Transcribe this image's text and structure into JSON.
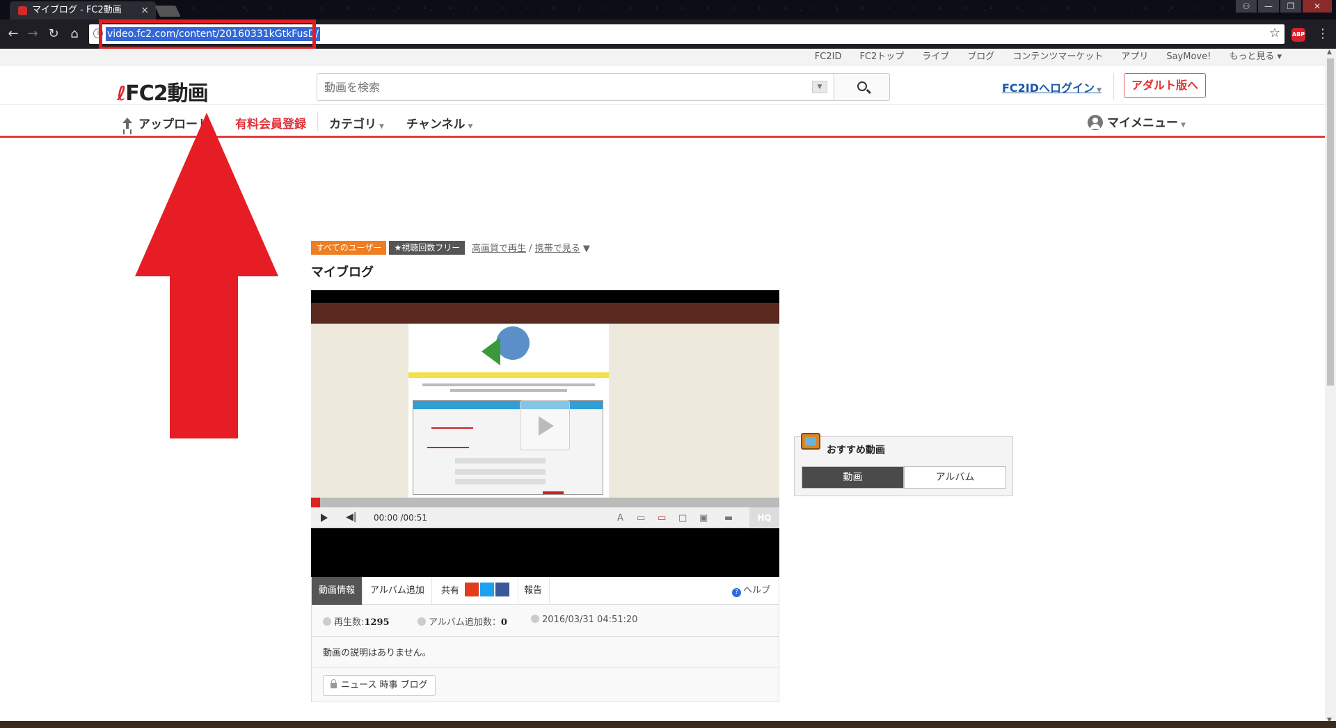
{
  "browser": {
    "tab_title": "マイブログ - FC2動画",
    "tab_close": "×",
    "url": "video.fc2.com/content/20160331kGtkFusD/",
    "abp_label": "ABP",
    "nav": {
      "back": "←",
      "forward": "→",
      "reload": "↻",
      "home": "⌂",
      "star": "☆",
      "menu": "⋮"
    },
    "window_controls": {
      "user": "⚇",
      "minimize": "—",
      "maximize": "❐",
      "close": "✕"
    }
  },
  "topnav": {
    "items": [
      "FC2ID",
      "FC2トップ",
      "ライブ",
      "ブログ",
      "コンテンツマーケット",
      "アプリ",
      "SayMove!",
      "もっと見る ▾"
    ]
  },
  "header": {
    "logo_text": "FC2動画",
    "search_placeholder": "動画を検索",
    "login_label": "FC2IDへログイン",
    "adult_label": "アダルト版へ"
  },
  "subnav": {
    "upload_label": "アップロード",
    "premium_label": "有料会員登録",
    "category_label": "カテゴリ",
    "channel_label": "チャンネル",
    "mymenu_label": "マイメニュー"
  },
  "video": {
    "tag_all": "すべてのユーザー",
    "tag_free": "★視聴回数フリー",
    "hq_link": "高画質で再生",
    "link_sep": "/",
    "mobile_link": "携帯で見る",
    "link_caret": "▼",
    "title": "マイブログ",
    "time": "00:00 /00:51",
    "hq_button": "HQ",
    "progress": 0.02
  },
  "video_tabs": {
    "info": "動画情報",
    "album_add": "アルバム追加",
    "share": "共有",
    "report": "報告",
    "help": "ヘルプ"
  },
  "stats": {
    "plays_label": "再生数:",
    "plays": "1295",
    "album_label": "アルバム追加数：",
    "album_count": "0",
    "date": "2016/03/31 04:51:20"
  },
  "description": "動画の説明はありません。",
  "video_tag": "ニュース 時事 ブログ",
  "recommend": {
    "title": "おすすめ動画",
    "tab_video": "動画",
    "tab_album": "アルバム"
  },
  "colors": {
    "annotation_red": "#e11d24",
    "fc2_red": "#e0323a",
    "tag_orange": "#ef7d22",
    "link_blue": "#1a57a8"
  }
}
